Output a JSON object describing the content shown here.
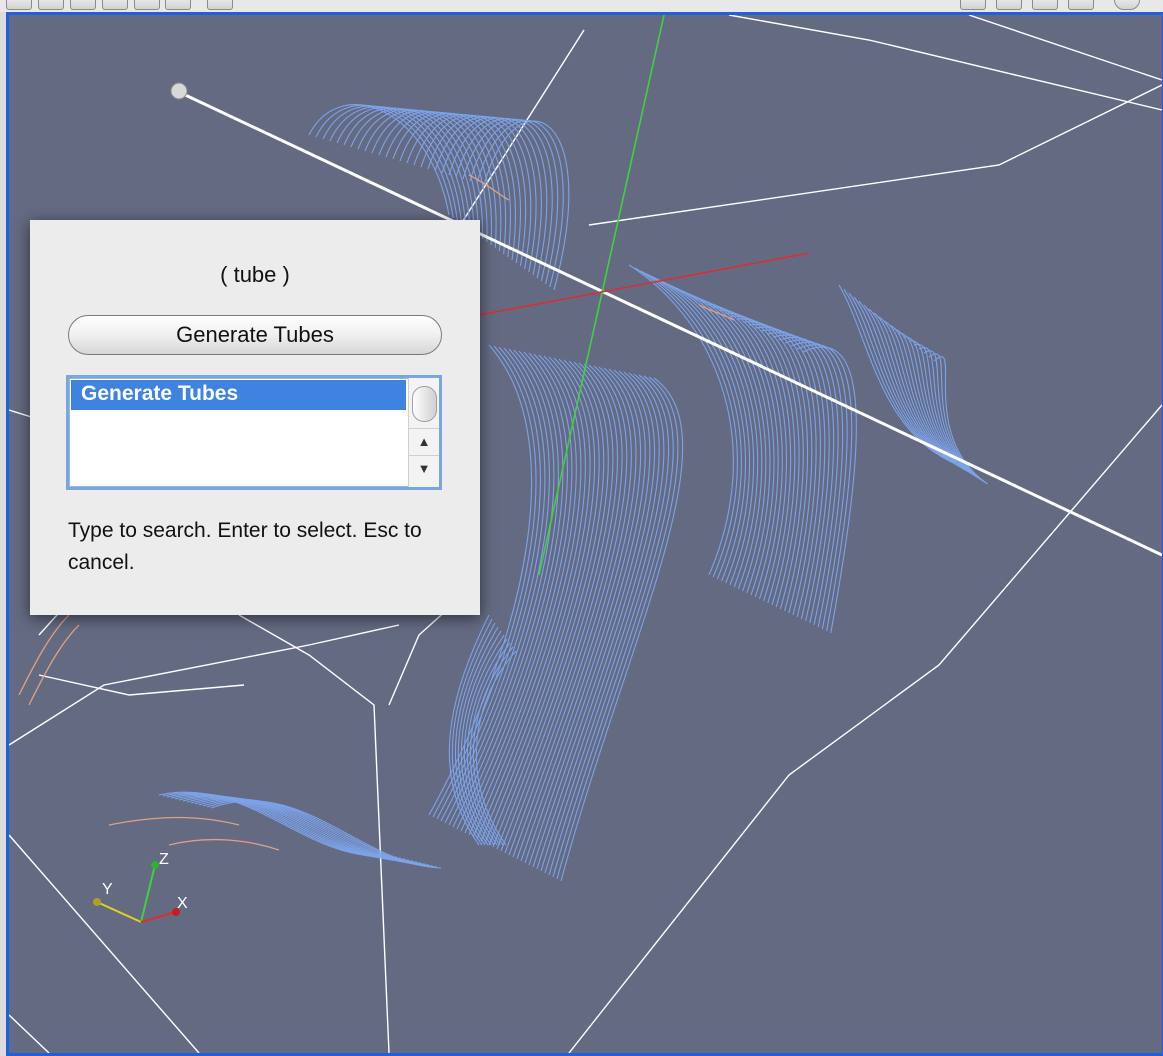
{
  "colors": {
    "viewport_bg": "#646a82",
    "viewport_border": "#1f5fe0",
    "streamline": "#7ea6ee",
    "domain_lines": "#ffffff",
    "axis_x": "#d83030",
    "axis_y": "#e0d020",
    "axis_z": "#40d040",
    "selection": "#3f82df"
  },
  "quick_launch": {
    "title": "( tube )",
    "button_label": "Generate Tubes",
    "results": [
      "Generate Tubes"
    ],
    "hint": "Type to search. Enter to select. Esc to cancel."
  },
  "orientation_axes": {
    "x_label": "X",
    "y_label": "Y",
    "z_label": "Z"
  }
}
